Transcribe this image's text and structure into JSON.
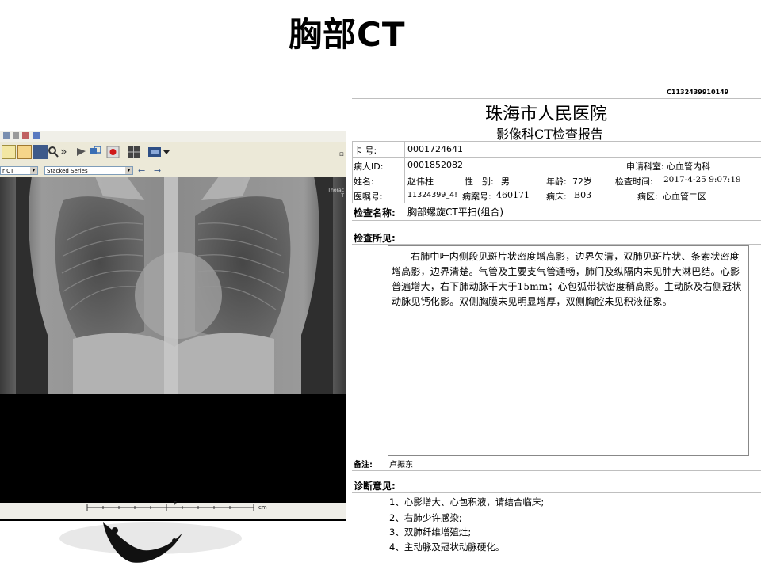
{
  "slide": {
    "title": "胸部CT"
  },
  "viewer": {
    "dropdown1": "r CT",
    "dropdown2": "Stacked Series",
    "side_label_1": "Thorac",
    "side_label_2": "T",
    "ruler_unit": "cm",
    "ruler_mark": "F"
  },
  "report": {
    "code": "C1132439910149",
    "hospital": "珠海市人民医院",
    "subtitle": "影像科CT检查报告",
    "card_label": "卡 号:",
    "card_value": "0001724641",
    "patient_id_label": "病人ID:",
    "patient_id_value": "0001852082",
    "dept_label": "申请科室:",
    "dept_value": "心血管内科",
    "name_label": "姓名:",
    "name_value": "赵伟柱",
    "sex_label": "性　别:",
    "sex_value": "男",
    "age_label": "年龄:",
    "age_value": "72岁",
    "time_label": "检查时间:",
    "time_value": "2017-4-25 9:07:19",
    "order_label": "医嘱号:",
    "order_value": "11324399_4!",
    "case_label": "病案号:",
    "case_value": "460171",
    "bed_label": "病床:",
    "bed_value": "B03",
    "ward_label": "病区:",
    "ward_value": "心血管二区",
    "exam_name_label": "检查名称:",
    "exam_name_value": "胸部螺旋CT平扫(组合)",
    "findings_label": "检查所见:",
    "findings_text": "右肺中叶内侧段见斑片状密度增高影，边界欠清，双肺见斑片状、条索状密度增高影，边界清楚。气管及主要支气管通畅，肺门及纵隔内未见肿大淋巴结。心影普遍增大，右下肺动脉干大于15mm；心包弧带状密度稍高影。主动脉及右侧冠状动脉见钙化影。双侧胸膜未见明显增厚，双侧胸腔未见积液征象。",
    "remark_label": "备注:",
    "remark_value": "卢振东",
    "diagnosis_label": "诊断意见:",
    "diagnosis": [
      "1、心影增大、心包积液，请结合临床;",
      "2、右肺少许感染;",
      "3、双肺纤维增殖灶;",
      "4、主动脉及冠状动脉硬化。"
    ]
  }
}
